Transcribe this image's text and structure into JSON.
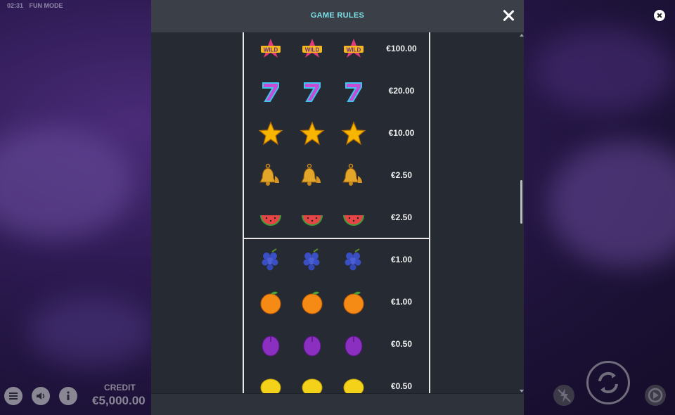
{
  "status": {
    "time": "02:31",
    "mode": "FUN MODE"
  },
  "modal": {
    "title": "GAME RULES"
  },
  "paytable": {
    "upper": [
      {
        "symbol": "wild-icon",
        "prize": "€100.00"
      },
      {
        "symbol": "seven-icon",
        "prize": "€20.00"
      },
      {
        "symbol": "star-icon",
        "prize": "€10.00"
      },
      {
        "symbol": "bell-icon",
        "prize": "€2.50"
      },
      {
        "symbol": "watermelon-icon",
        "prize": "€2.50"
      }
    ],
    "lower": [
      {
        "symbol": "grapes-icon",
        "prize": "€1.00"
      },
      {
        "symbol": "orange-icon",
        "prize": "€1.00"
      },
      {
        "symbol": "plum-icon",
        "prize": "€0.50"
      },
      {
        "symbol": "lemon-icon",
        "prize": "€0.50"
      }
    ]
  },
  "credit": {
    "label": "CREDIT",
    "value": "€5,000.00"
  },
  "colors": {
    "accent": "#7ee0e6",
    "modal_bg": "#252a33",
    "header_bg": "#3a3f48"
  }
}
